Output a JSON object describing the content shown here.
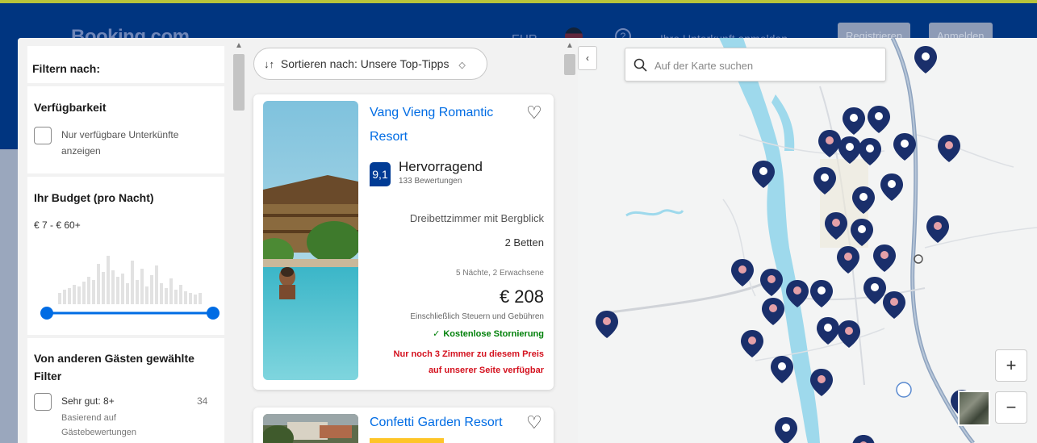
{
  "header": {
    "brand": "Booking.com",
    "currency": "EUR",
    "help": "?",
    "list_property": "Ihre Unterkunft anmelden",
    "register": "Registrieren",
    "signin": "Anmelden"
  },
  "filters": {
    "title": "Filtern nach:",
    "availability": {
      "heading": "Verfügbarkeit",
      "option_line1": "Nur verfügbare Unterkünfte",
      "option_line2": "anzeigen"
    },
    "budget": {
      "heading": "Ihr Budget (pro Nacht)",
      "range": "€ 7 - € 60+"
    },
    "popular": {
      "heading_line1": "Von anderen Gästen gewählte",
      "heading_line2": "Filter",
      "option_label": "Sehr gut: 8+",
      "option_count": "34",
      "option_sub1": "Basierend auf",
      "option_sub2": "Gästebewertungen"
    }
  },
  "results": {
    "sort_label": "Sortieren nach: Unsere Top-Tipps",
    "cards": [
      {
        "name_line1": "Vang Vieng Romantic",
        "name_line2": "Resort",
        "score": "9,1",
        "score_label": "Hervorragend",
        "reviews": "133 Bewertungen",
        "room": "Dreibettzimmer mit Bergblick",
        "beds": "2 Betten",
        "stay": "5 Nächte, 2 Erwachsene",
        "price": "€ 208",
        "taxes": "Einschließlich Steuern und Gebühren",
        "cancellation": "Kostenlose Stornierung",
        "scarcity_line1": "Nur noch 3 Zimmer zu diesem Preis",
        "scarcity_line2": "auf unserer Seite verfügbar"
      },
      {
        "name_line1": "Confetti Garden Resort"
      }
    ]
  },
  "map": {
    "search_placeholder": "Auf der Karte suchen",
    "zoom_in": "+",
    "zoom_out": "−",
    "collapse": "‹"
  },
  "icons": {
    "sort": "sort-arrows-icon",
    "favorite": "heart-icon",
    "check": "check-icon",
    "search": "search-icon",
    "pin": "map-pin-icon"
  },
  "colors": {
    "brand_blue": "#003580",
    "link_blue": "#006ce4",
    "score_blue": "#003b95",
    "success_green": "#008009",
    "danger_red": "#d4111e",
    "pin_navy": "#1a2f6b"
  }
}
